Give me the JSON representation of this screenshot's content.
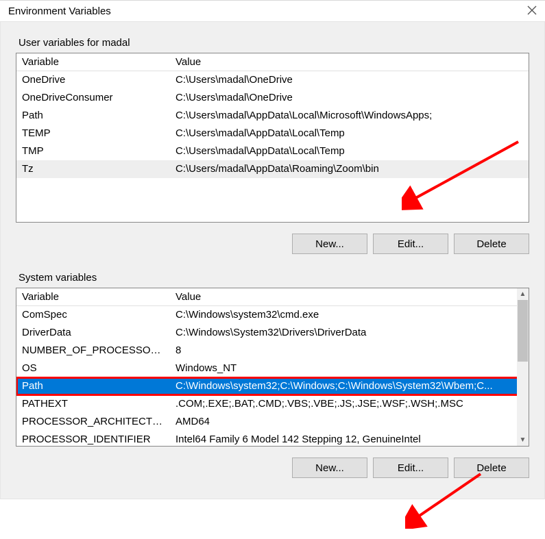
{
  "titlebar": {
    "title": "Environment Variables"
  },
  "user_section": {
    "label": "User variables for madal",
    "headers": {
      "variable": "Variable",
      "value": "Value"
    },
    "rows": [
      {
        "variable": "OneDrive",
        "value": "C:\\Users\\madal\\OneDrive"
      },
      {
        "variable": "OneDriveConsumer",
        "value": "C:\\Users\\madal\\OneDrive"
      },
      {
        "variable": "Path",
        "value": "C:\\Users\\madal\\AppData\\Local\\Microsoft\\WindowsApps;"
      },
      {
        "variable": "TEMP",
        "value": "C:\\Users\\madal\\AppData\\Local\\Temp"
      },
      {
        "variable": "TMP",
        "value": "C:\\Users\\madal\\AppData\\Local\\Temp"
      },
      {
        "variable": "Tz",
        "value": "C:\\Users/madal\\AppData\\Roaming\\Zoom\\bin"
      }
    ],
    "buttons": {
      "new": "New...",
      "edit": "Edit...",
      "delete": "Delete"
    }
  },
  "system_section": {
    "label": "System variables",
    "headers": {
      "variable": "Variable",
      "value": "Value"
    },
    "rows": [
      {
        "variable": "ComSpec",
        "value": "C:\\Windows\\system32\\cmd.exe"
      },
      {
        "variable": "DriverData",
        "value": "C:\\Windows\\System32\\Drivers\\DriverData"
      },
      {
        "variable": "NUMBER_OF_PROCESSORS",
        "value": "8"
      },
      {
        "variable": "OS",
        "value": "Windows_NT"
      },
      {
        "variable": "Path",
        "value": "C:\\Windows\\system32;C:\\Windows;C:\\Windows\\System32\\Wbem;C..."
      },
      {
        "variable": "PATHEXT",
        "value": ".COM;.EXE;.BAT;.CMD;.VBS;.VBE;.JS;.JSE;.WSF;.WSH;.MSC"
      },
      {
        "variable": "PROCESSOR_ARCHITECTURE",
        "value": "AMD64"
      },
      {
        "variable": "PROCESSOR_IDENTIFIER",
        "value": "Intel64 Family 6 Model 142 Stepping 12, GenuineIntel"
      }
    ],
    "selected_index": 4,
    "buttons": {
      "new": "New...",
      "edit": "Edit...",
      "delete": "Delete"
    }
  }
}
